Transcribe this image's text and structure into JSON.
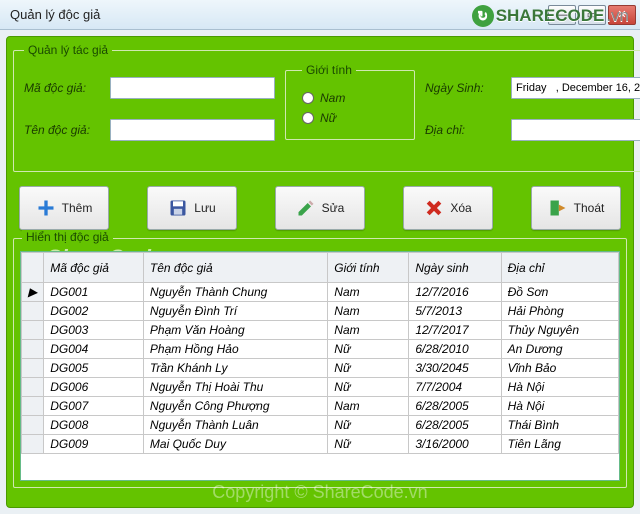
{
  "window": {
    "title": "Quản lý độc giả"
  },
  "logo": {
    "brand": "SHARECODE",
    "suffix": ".vn"
  },
  "form": {
    "legend": "Quản lý tác giả",
    "maDocGia": {
      "label": "Mã độc giả:",
      "value": ""
    },
    "tenDocGia": {
      "label": "Tên độc giả:",
      "value": ""
    },
    "gioiTinh": {
      "legend": "Giới tính",
      "nam": "Nam",
      "nu": "Nữ"
    },
    "ngaySinh": {
      "label": "Ngày Sinh:",
      "value": "Friday   , December 16, 2"
    },
    "diaChi": {
      "label": "Địa chỉ:",
      "value": ""
    }
  },
  "toolbar": {
    "them": "Thêm",
    "luu": "Lưu",
    "sua": "Sửa",
    "xoa": "Xóa",
    "thoat": "Thoát"
  },
  "grid": {
    "legend": "Hiển thị độc giả",
    "columns": {
      "c1": "Mã độc giả",
      "c2": "Tên độc giả",
      "c3": "Giới tính",
      "c4": "Ngày sinh",
      "c5": "Địa chỉ"
    },
    "rows": [
      {
        "ma": "DG001",
        "ten": "Nguyễn Thành Chung",
        "gt": "Nam",
        "ns": "12/7/2016",
        "dc": "Đồ Sơn"
      },
      {
        "ma": "DG002",
        "ten": "Nguyễn Đình Trí",
        "gt": "Nam",
        "ns": "5/7/2013",
        "dc": "Hải Phòng"
      },
      {
        "ma": "DG003",
        "ten": "Phạm Văn Hoàng",
        "gt": "Nam",
        "ns": "12/7/2017",
        "dc": "Thủy Nguyên"
      },
      {
        "ma": "DG004",
        "ten": "Phạm Hồng Hảo",
        "gt": "Nữ",
        "ns": "6/28/2010",
        "dc": "An Dương"
      },
      {
        "ma": "DG005",
        "ten": "Trần Khánh Ly",
        "gt": "Nữ",
        "ns": "3/30/2045",
        "dc": "Vĩnh Bảo"
      },
      {
        "ma": "DG006",
        "ten": "Nguyễn Thị Hoài Thu",
        "gt": "Nữ",
        "ns": "7/7/2004",
        "dc": "Hà Nội"
      },
      {
        "ma": "DG007",
        "ten": "Nguyễn Công Phượng",
        "gt": "Nam",
        "ns": "6/28/2005",
        "dc": "Hà Nội"
      },
      {
        "ma": "DG008",
        "ten": "Nguyễn Thành Luân",
        "gt": "Nữ",
        "ns": "6/28/2005",
        "dc": "Thái Bình"
      },
      {
        "ma": "DG009",
        "ten": "Mai Quốc Duy",
        "gt": "Nữ",
        "ns": "3/16/2000",
        "dc": "Tiên Lãng"
      }
    ]
  },
  "watermark": {
    "w1": "ShareCode.vn",
    "w2": "Copyright © ShareCode.vn"
  }
}
